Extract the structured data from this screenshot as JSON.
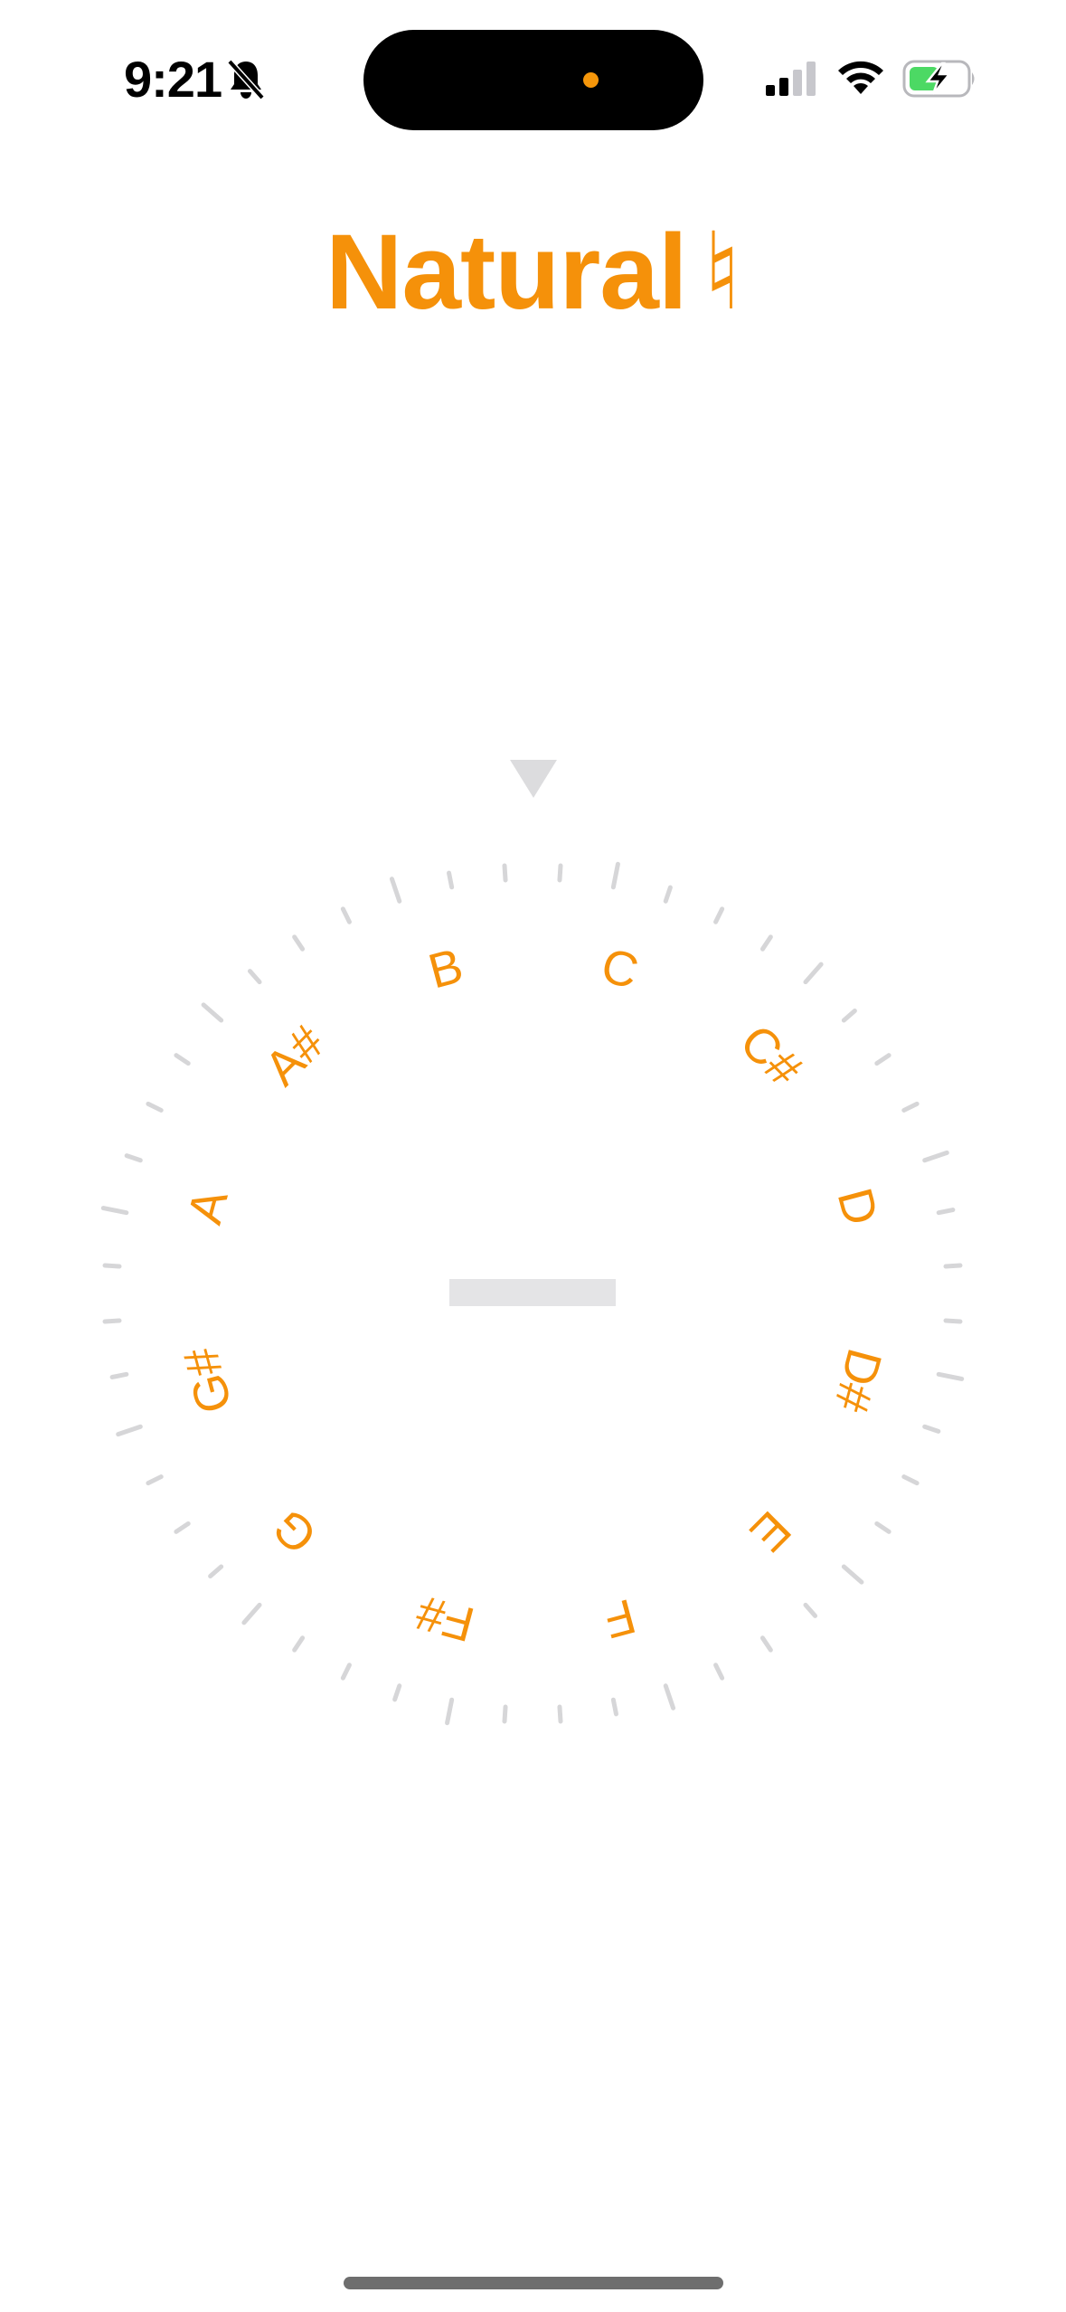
{
  "status_bar": {
    "time": "9:21",
    "silent_icon": "bell-slash-icon",
    "signal_icon": "cellular-signal-icon",
    "wifi_icon": "wifi-icon",
    "battery_icon": "battery-charging-icon",
    "battery_color": "#4cd964"
  },
  "app": {
    "title": "Natural",
    "title_symbol": "♮",
    "accent_color": "#f5910a"
  },
  "tuner": {
    "pointer_icon": "triangle-pointer-icon",
    "notes": [
      "C",
      "C#",
      "D",
      "D#",
      "E",
      "F",
      "F#",
      "G",
      "G#",
      "A",
      "A#",
      "B"
    ],
    "tick_color": "#d6d6d8",
    "reading_bar_color": "#e4e4e6"
  }
}
